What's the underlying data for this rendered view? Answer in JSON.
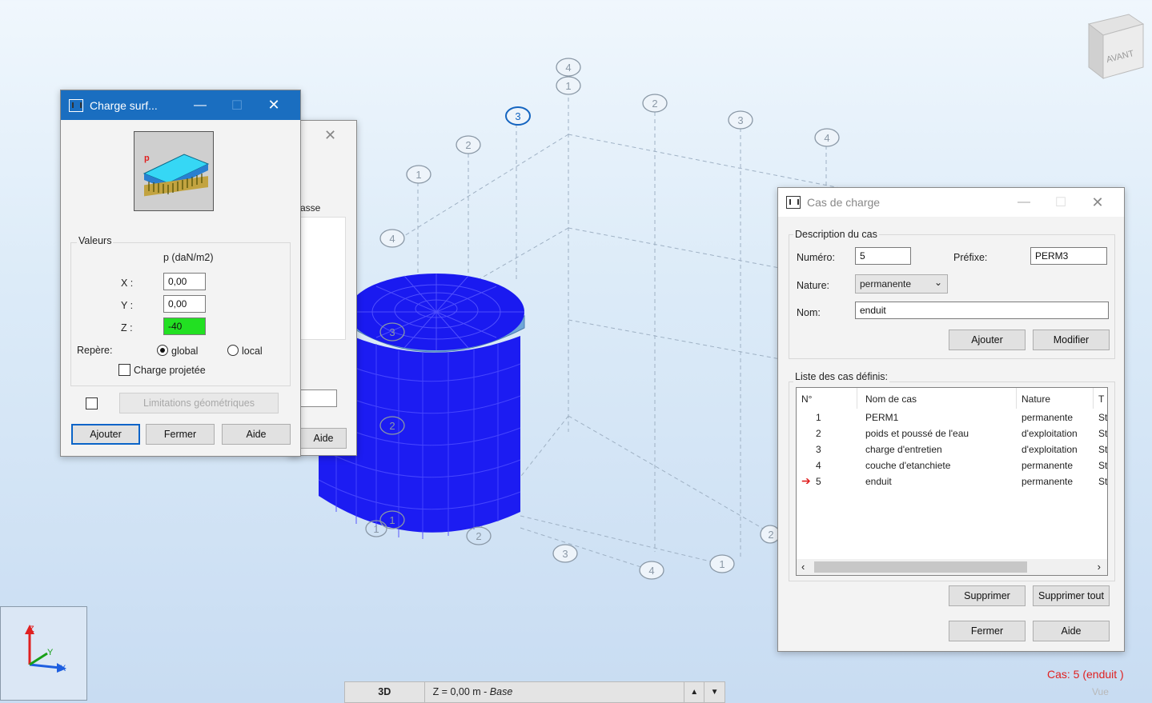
{
  "viewport": {
    "view_cube_label": "AVANT",
    "axis_labels": {
      "x": "X",
      "y": "Y",
      "z": "Z"
    },
    "grid_labels": {
      "top_4": "4",
      "top_1": "1",
      "top_3": "3",
      "top_2a": "2",
      "top_2b": "2",
      "top_1b": "1",
      "top_3b": "3",
      "top_4b": "4",
      "left_4": "4",
      "cyl_3": "3",
      "cyl_2": "2",
      "cyl_1": "1",
      "cyl_1b": "1",
      "bot_2": "2",
      "bot_3": "3",
      "bot_4": "4",
      "bot_1": "1",
      "bot_2b": "2"
    },
    "status_case": "Cas: 5 (enduit )",
    "status_vue": "Vue",
    "colors": {
      "structure": "#1a1aff",
      "selected_grid": "#1565c0"
    }
  },
  "charge_dialog": {
    "title": "Charge surf...",
    "minimize": "—",
    "close": "✕",
    "group_label": "Valeurs",
    "unit_label": "p  (daN/m2)",
    "x_label": "X :",
    "x_value": "0,00",
    "y_label": "Y :",
    "y_value": "0,00",
    "z_label": "Z :",
    "z_value": "-40",
    "repere_label": "Repère:",
    "radio_global": "global",
    "radio_local": "local",
    "charge_projetee": "Charge projetée",
    "limitations_button": "Limitations géométriques",
    "ajouter": "Ajouter",
    "fermer": "Fermer",
    "aide": "Aide"
  },
  "behind_dialog": {
    "close": "✕",
    "tab_fragment": "asse",
    "aide": "Aide"
  },
  "cas_dialog": {
    "title": "Cas de charge",
    "minimize": "—",
    "close": "✕",
    "description_label": "Description du cas",
    "numero_label": "Numéro:",
    "numero_value": "5",
    "prefixe_label": "Préfixe:",
    "prefixe_value": "PERM3",
    "nature_label": "Nature:",
    "nature_value": "permanente",
    "nom_label": "Nom:",
    "nom_value": "enduit",
    "ajouter": "Ajouter",
    "modifier": "Modifier",
    "liste_label": "Liste des cas définis:",
    "columns": [
      "N°",
      "Nom de cas",
      "Nature",
      "T"
    ],
    "rows": [
      {
        "n": "1",
        "nom": "PERM1",
        "nature": "permanente",
        "t": "St"
      },
      {
        "n": "2",
        "nom": "poids et poussé de l'eau",
        "nature": "d'exploitation",
        "t": "St"
      },
      {
        "n": "3",
        "nom": "charge d'entretien",
        "nature": "d'exploitation",
        "t": "St"
      },
      {
        "n": "4",
        "nom": "couche d'etanchiete",
        "nature": "permanente",
        "t": "St"
      },
      {
        "n": "5",
        "nom": "enduit",
        "nature": "permanente",
        "t": "St"
      }
    ],
    "supprimer": "Supprimer",
    "supprimer_tout": "Supprimer tout",
    "fermer": "Fermer",
    "aide": "Aide"
  },
  "statusbar": {
    "view_mode": "3D",
    "level": "Z = 0,00 m - ",
    "level_name": "Base",
    "up": "▲",
    "down": "▼"
  }
}
